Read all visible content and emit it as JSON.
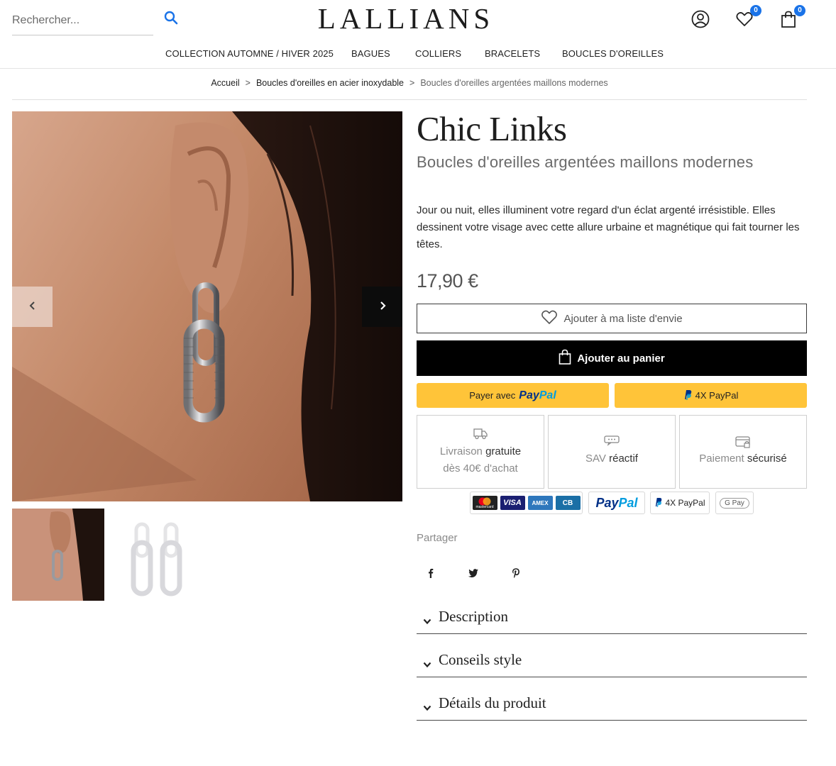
{
  "header": {
    "search_placeholder": "Rechercher...",
    "logo": "LALLIANS",
    "wishlist_count": "0",
    "cart_count": "0"
  },
  "nav": {
    "items": [
      {
        "label": "COLLECTION AUTOMNE / HIVER 2025"
      },
      {
        "label": "BAGUES"
      },
      {
        "label": "COLLIERS"
      },
      {
        "label": "BRACELETS"
      },
      {
        "label": "BOUCLES D'OREILLES"
      }
    ]
  },
  "breadcrumb": {
    "items": [
      "Accueil",
      "Boucles d'oreilles en acier inoxydable"
    ],
    "separator": ">",
    "current": "Boucles d'oreilles argentées maillons modernes"
  },
  "product": {
    "title": "Chic Links",
    "subtitle": "Boucles d'oreilles argentées maillons modernes",
    "description": "Jour ou nuit, elles illuminent votre regard d'un éclat argenté irrésistible. Elles dessinent votre visage avec cette allure urbaine et magnétique qui fait tourner les têtes.",
    "price": "17,90 €"
  },
  "actions": {
    "wishlist_label": "Ajouter à ma liste d'envie",
    "cart_label": "Ajouter au panier",
    "paypal_prefix": "Payer avec",
    "paypal_pay": "Pay",
    "paypal_pal": "Pal",
    "paypal_4x": "4X PayPal"
  },
  "features": [
    {
      "line1_a": "Livraison ",
      "line1_b": "gratuite",
      "line2": "dès 40€ d'achat"
    },
    {
      "line1_a": "SAV ",
      "line1_b": "réactif"
    },
    {
      "line1_a": "Paiement ",
      "line1_b": "sécurisé"
    }
  ],
  "payment_logos": {
    "mastercard": "mastercard",
    "visa": "VISA",
    "amex": "AMEX",
    "cb": "CB",
    "paypal_pay": "Pay",
    "paypal_pal": "Pal",
    "paypal_4x": "4X PayPal",
    "gpay": "G Pay"
  },
  "share": {
    "label": "Partager"
  },
  "accordions": [
    {
      "label": "Description"
    },
    {
      "label": "Conseils style"
    },
    {
      "label": "Détails du produit"
    }
  ],
  "colors": {
    "badge": "#1a73e8",
    "paypal_yellow": "#ffc439",
    "paypal_dark_blue": "#003087",
    "paypal_light_blue": "#009cde",
    "cart_button": "#000000"
  }
}
